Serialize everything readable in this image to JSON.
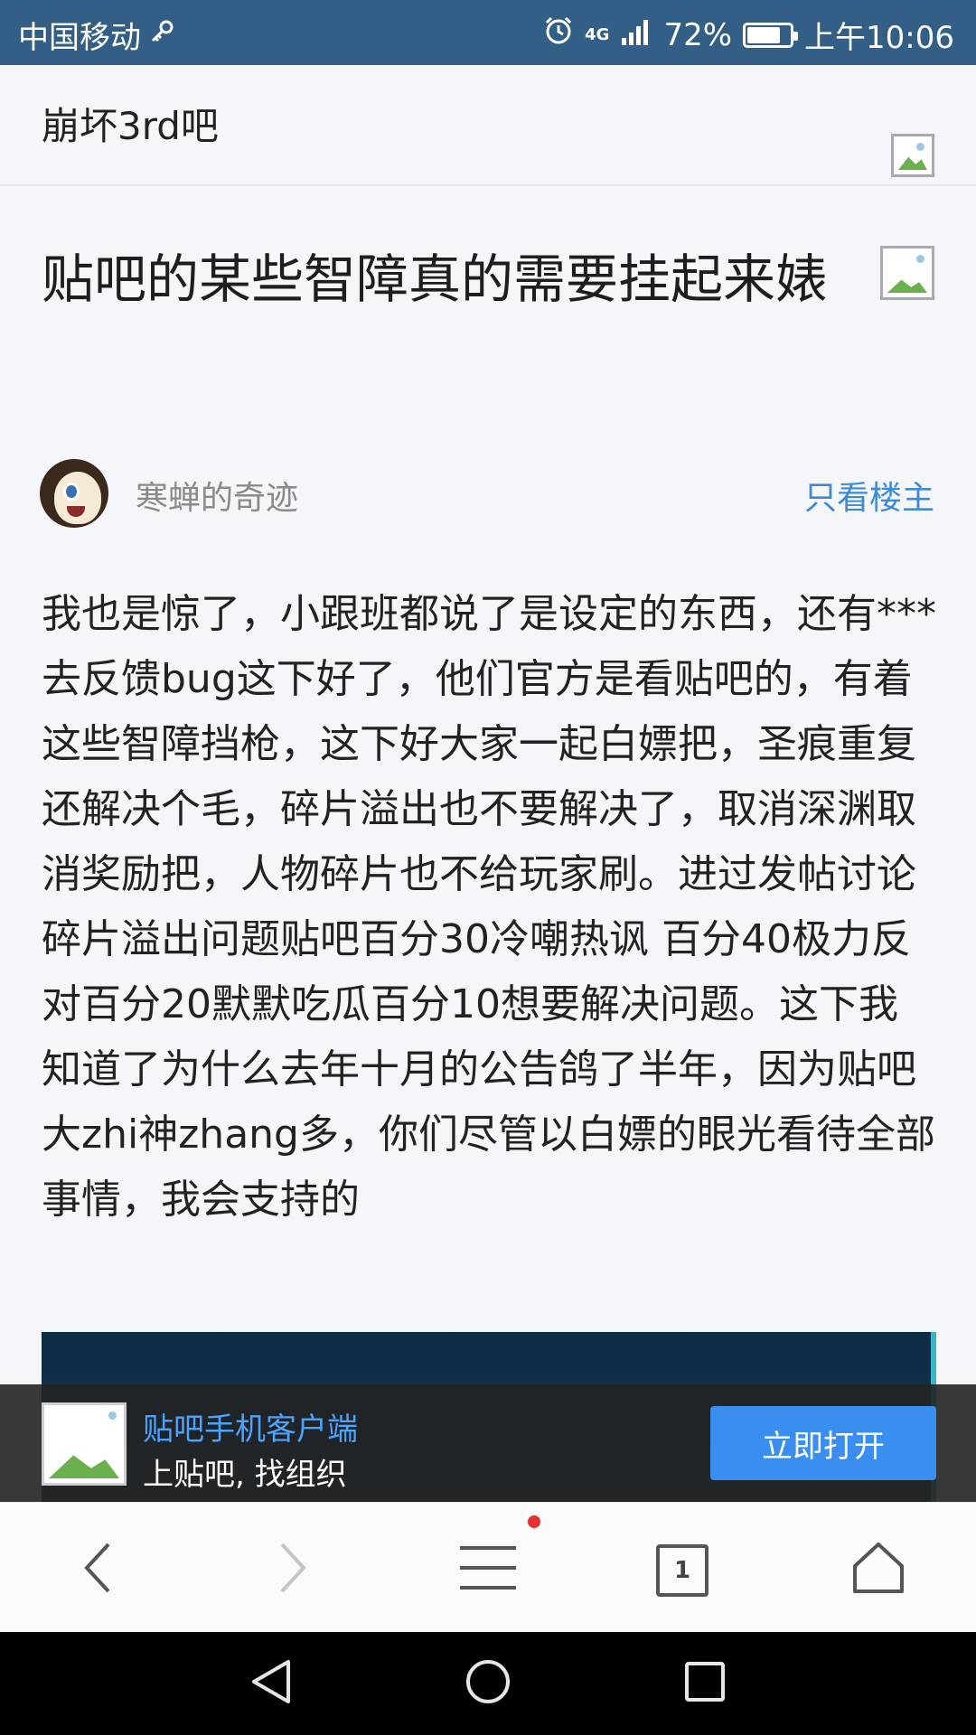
{
  "status_bar": {
    "carrier": "中国移动",
    "network": "4G",
    "battery": "72%",
    "battery_level": 0.72,
    "time": "上午10:06"
  },
  "header": {
    "forum_name": "崩坏3rd吧"
  },
  "post": {
    "title": "贴吧的某些智障真的需要挂起来婊",
    "author": "寒蝉的奇迹",
    "only_op_label": "只看楼主",
    "body": "我也是惊了，小跟班都说了是设定的东西，还有***去反馈bug这下好了，他们官方是看贴吧的，有着这些智障挡枪，这下好大家一起白嫖把，圣痕重复还解决个毛，碎片溢出也不要解决了，取消深渊取消奖励把，人物碎片也不给玩家刷。进过发帖讨论碎片溢出问题贴吧百分30冷嘲热讽 百分40极力反对百分20默默吃瓜百分10想要解决问题。这下我知道了为什么去年十月的公告鸽了半年，因为贴吧大zhi神zhang多，你们尽管以白嫖的眼光看待全部事情，我会支持的"
  },
  "app_banner": {
    "app_name": "贴吧手机客户端",
    "slogan": "上贴吧, 找组织",
    "open_button": "立即打开"
  },
  "browser_toolbar": {
    "tab_count": "1",
    "icons": [
      "back-icon",
      "forward-icon",
      "menu-icon",
      "tabs-icon",
      "home-icon"
    ]
  },
  "nav_bar": {
    "icons": [
      "nav-back-icon",
      "nav-home-icon",
      "nav-recents-icon"
    ]
  },
  "colors": {
    "status_bar": "#335f86",
    "link_blue": "#3f8ad8",
    "button_blue": "#3a8ef0",
    "background": "#f4f6f9"
  }
}
